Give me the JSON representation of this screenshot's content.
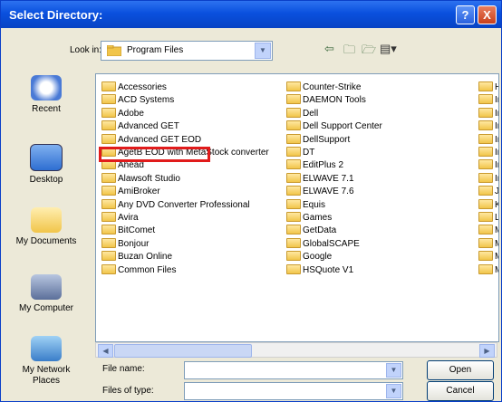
{
  "window": {
    "title": "Select Directory:"
  },
  "titlebar": {
    "help": "?",
    "close": "X"
  },
  "lookin": {
    "label": "Look in:",
    "value": "Program Files"
  },
  "places": [
    {
      "label": "Recent"
    },
    {
      "label": "Desktop"
    },
    {
      "label": "My Documents"
    },
    {
      "label": "My Computer"
    },
    {
      "label": "My Network Places"
    }
  ],
  "files": {
    "col1": [
      "Accessories",
      "ACD Systems",
      "Adobe",
      "Advanced GET",
      "Advanced GET EOD",
      "AgetB EOD with MetaStock converter",
      "Ahead",
      "Alawsoft Studio",
      "AmiBroker",
      "Any DVD Converter Professional",
      "Avira",
      "BitComet",
      "Bonjour",
      "Buzan Online",
      "Common Files"
    ],
    "col2": [
      "Counter-Strike",
      "DAEMON Tools",
      "Dell",
      "Dell Support Center",
      "DellSupport",
      "DT",
      "EditPlus 2",
      "ELWAVE 7.1",
      "ELWAVE 7.6",
      "Equis",
      "Games",
      "GetData",
      "GlobalSCAPE",
      "Google",
      "HSQuote V1"
    ],
    "col3": [
      "H",
      "In",
      "In",
      "In",
      "In",
      "In",
      "In",
      "In",
      "Ja",
      "K-",
      "Lo",
      "M",
      "M",
      "M",
      "M"
    ]
  },
  "fields": {
    "filename_label": "File name:",
    "filetype_label": "Files of type:",
    "filename_value": "",
    "filetype_value": ""
  },
  "buttons": {
    "open": "Open",
    "cancel": "Cancel"
  }
}
